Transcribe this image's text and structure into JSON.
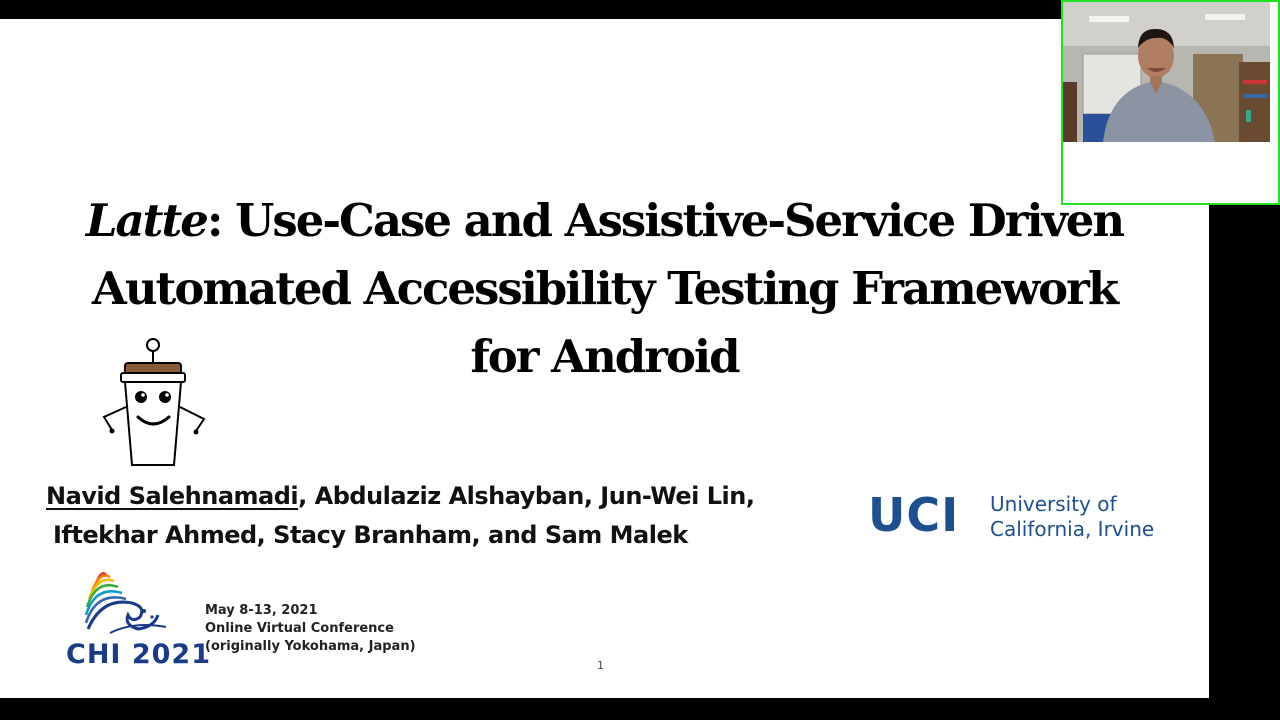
{
  "slide": {
    "title": {
      "emphasis": "Latte",
      "line1_rest": ": Use-Case and Assistive-Service Driven",
      "line2": "Automated Accessibility Testing Framework",
      "line3": "for Android"
    },
    "authors": {
      "presenter": "Navid Salehnamadi",
      "line1_rest": ", Abdulaziz Alshayban, Jun-Wei Lin,",
      "line2": "Iftekhar Ahmed, Stacy Branham, and Sam Malek"
    },
    "university": {
      "mark": "UCI",
      "name_line1": "University of",
      "name_line2": "California, Irvine",
      "color": "#1d4f91"
    },
    "conference": {
      "logo_text": "CHI 2021",
      "dates": "May 8-13, 2021",
      "mode": "Online Virtual Conference",
      "location": "(originally Yokohama, Japan)"
    },
    "page_number": "1"
  },
  "video_overlay": {
    "border_color": "#22e022",
    "subject": "presenter-webcam"
  }
}
